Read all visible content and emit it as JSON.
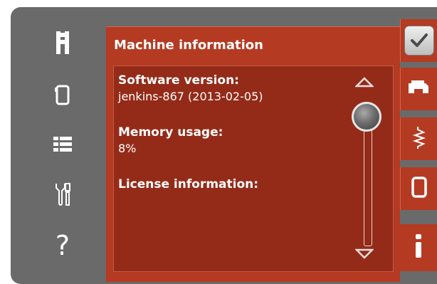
{
  "panel": {
    "title": "Machine information",
    "software_label": "Software version:",
    "software_value": "jenkins-867 (2013-02-05)",
    "memory_label": "Memory usage:",
    "memory_value": "8%",
    "license_label": "License information:"
  },
  "left_nav": {
    "items": [
      {
        "icon": "presser-foot-icon"
      },
      {
        "icon": "hoop-icon"
      },
      {
        "icon": "list-icon"
      },
      {
        "icon": "tools-icon"
      },
      {
        "icon": "help-icon",
        "glyph": "?"
      }
    ]
  },
  "right_tabs": {
    "items": [
      {
        "icon": "checkmark-icon"
      },
      {
        "icon": "sewing-machine-icon"
      },
      {
        "icon": "stitch-icon"
      },
      {
        "icon": "hoop-icon"
      },
      {
        "icon": "info-icon",
        "active": true
      }
    ]
  },
  "colors": {
    "frame": "#6a6a6a",
    "panel": "#b53a22",
    "content": "#942b18",
    "text": "#ffffff"
  }
}
